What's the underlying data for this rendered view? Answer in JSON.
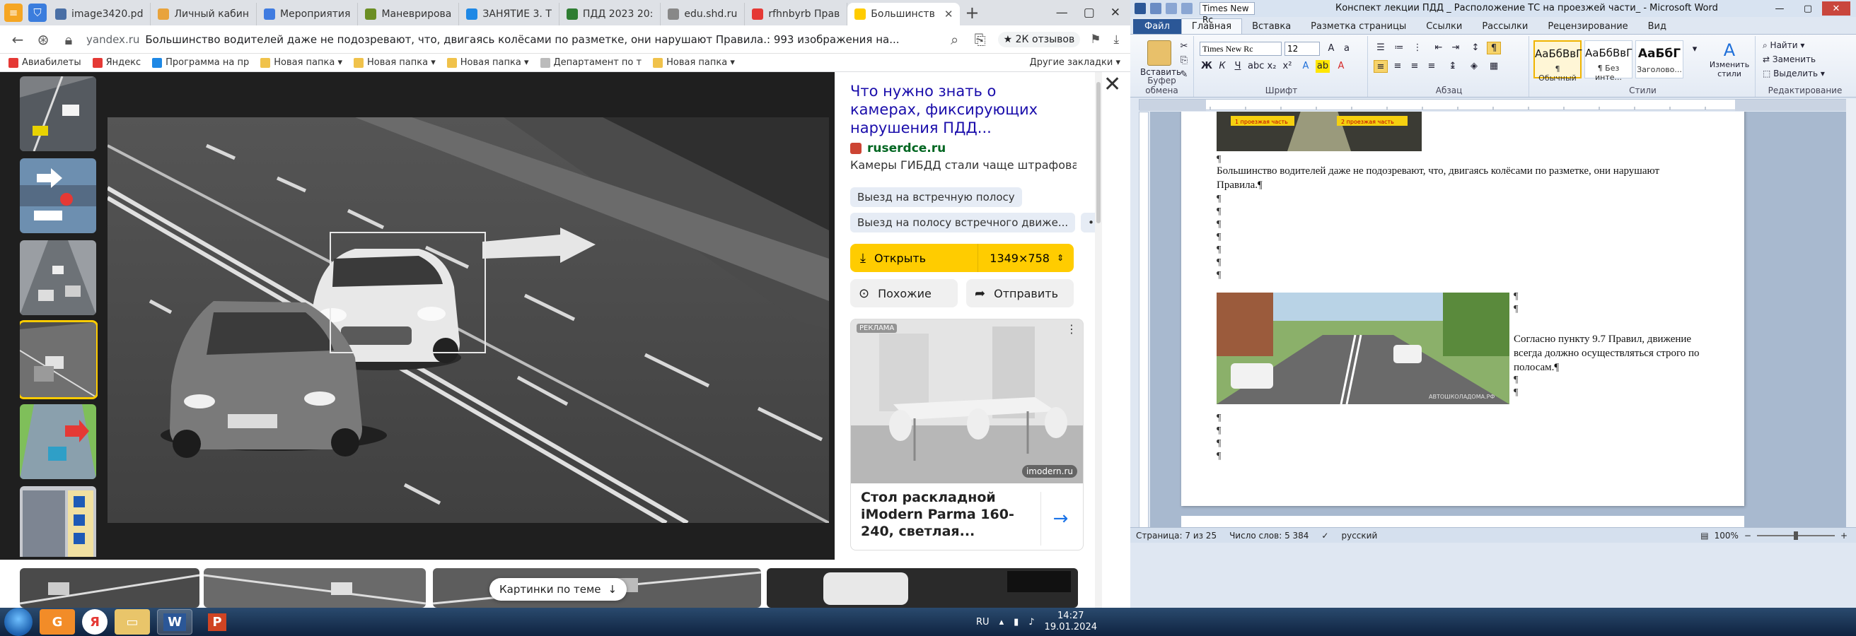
{
  "browser": {
    "tabs": [
      {
        "label": "image3420.pd",
        "color": "#4a6fa5"
      },
      {
        "label": "Личный кабин",
        "color": "#e8a33c"
      },
      {
        "label": "Мероприятия",
        "color": "#3f7be0"
      },
      {
        "label": "Маневрирова",
        "color": "#6b8e23"
      },
      {
        "label": "ЗАНЯТИЕ 3. Т",
        "color": "#1e88e5"
      },
      {
        "label": "ПДД 2023 20:",
        "color": "#2e7d32"
      },
      {
        "label": "edu.shd.ru",
        "color": "#888888"
      },
      {
        "label": "rfhnbyrb Прав",
        "color": "#e53935"
      },
      {
        "label": "Большинств",
        "color": "#ffcc00"
      }
    ],
    "tab_close": "✕",
    "new_tab": "+",
    "window_controls": [
      "—",
      "▢",
      "✕"
    ],
    "address": {
      "host": "yandex.ru",
      "page_title": "Большинство водителей даже не подозревают, что, двигаясь колёсами по разметке, они нарушают Правила.: 993 изображения на...",
      "reviews": "★ 2К отзывов"
    },
    "bookmarks": [
      {
        "label": "Авиабилеты",
        "color": "#e53935"
      },
      {
        "label": "Яндекс",
        "color": "#e53935"
      },
      {
        "label": "Программа на пр",
        "color": "#1e88e5"
      },
      {
        "label": "Новая папка ▾",
        "color": "#f0c24b"
      },
      {
        "label": "Новая папка ▾",
        "color": "#f0c24b"
      },
      {
        "label": "Новая папка ▾",
        "color": "#f0c24b"
      },
      {
        "label": "Департамент по т",
        "color": "#888888"
      },
      {
        "label": "Новая папка ▾",
        "color": "#f0c24b"
      }
    ],
    "bookmarks_other": "Другие закладки ▾",
    "viewer": {
      "panel_title": "Что нужно знать о камерах, фиксирующих нарушения ПДД...",
      "site": "ruserdce.ru",
      "description": "Камеры ГИБДД стали чаще штрафовать в...",
      "chips": [
        "Выезд на встречную полосу",
        "Выезд на полосу встречного движе...",
        "•••"
      ],
      "open_label": "Открыть",
      "resolution": "1349×758",
      "similar_label": "Похожие",
      "send_label": "Отправить",
      "ad_badge": "РЕКЛАМА",
      "ad_source": "imodern.ru",
      "ad_title": "Стол раскладной iModern Parma 160-240, светлая...",
      "more_images": "Картинки по теме",
      "close": "✕"
    }
  },
  "word": {
    "font_name": "Times New Rc",
    "doc_title": "Конспект лекции ПДД _ Расположение ТС на проезжей части_ - Microsoft Word",
    "tabs": [
      "Файл",
      "Главная",
      "Вставка",
      "Разметка страницы",
      "Ссылки",
      "Рассылки",
      "Рецензирование",
      "Вид"
    ],
    "ribbon": {
      "paste": "Вставить",
      "font_field": "Times New Rc",
      "size_field": "12",
      "clipboard_label": "Буфер обмена",
      "font_label": "Шрифт",
      "para_label": "Абзац",
      "styles_label": "Стили",
      "edit_label": "Редактирование",
      "styles": [
        {
          "sample": "АаБбВвГ",
          "name": "¶ Обычный"
        },
        {
          "sample": "АаБбВвГ",
          "name": "¶ Без инте..."
        },
        {
          "sample": "АаБбГ",
          "name": "Заголово..."
        }
      ],
      "change_styles": "Изменить стили",
      "find": "Найти ▾",
      "replace": "Заменить",
      "select": "Выделить ▾"
    },
    "doc": {
      "img1_labels": [
        "1 проезжая часть",
        "2 проезжая часть"
      ],
      "para1": "Большинство водителей даже не подозревают, что, двигаясь колёсами по разметке, они нарушают Правила.¶",
      "para2": "Согласно пункту 9.7 Правил, движение всегда должно осуществляться строго по полосам.¶",
      "watermark": "АВТОШКОЛАДОМА.РФ"
    },
    "status": {
      "page": "Страница: 7 из 25",
      "words": "Число слов: 5 384",
      "lang": "русский",
      "zoom": "100%"
    }
  },
  "taskbar": {
    "apps": [
      "Я",
      "",
      "W",
      "P"
    ],
    "lang": "RU",
    "time": "14:27",
    "date": "19.01.2024"
  }
}
